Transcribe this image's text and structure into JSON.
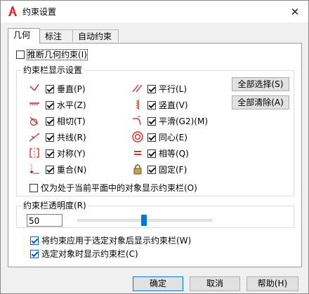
{
  "window": {
    "title": "约束设置",
    "close_glyph": "✕",
    "accent_color": "#0078d7"
  },
  "tabs": [
    {
      "label": "几何"
    },
    {
      "label": "标注"
    },
    {
      "label": "自动约束"
    }
  ],
  "infer": {
    "label": "推断几何约束(I)",
    "checked": false
  },
  "display_group": {
    "title": "约束栏显示设置",
    "left_items": [
      {
        "label": "垂直(P)",
        "icon": "perpendicular-icon",
        "checked": true
      },
      {
        "label": "水平(Z)",
        "icon": "horizontal-icon",
        "checked": true
      },
      {
        "label": "相切(T)",
        "icon": "tangent-icon",
        "checked": true
      },
      {
        "label": "共线(R)",
        "icon": "collinear-icon",
        "checked": true
      },
      {
        "label": "对称(Y)",
        "icon": "symmetric-icon",
        "checked": true
      },
      {
        "label": "重合(N)",
        "icon": "coincident-icon",
        "checked": true
      }
    ],
    "right_items": [
      {
        "label": "平行(L)",
        "icon": "parallel-icon",
        "checked": true
      },
      {
        "label": "竖直(V)",
        "icon": "vertical-icon",
        "checked": true
      },
      {
        "label": "平滑(G2)(M)",
        "icon": "smooth-icon",
        "checked": true
      },
      {
        "label": "同心(E)",
        "icon": "concentric-icon",
        "checked": true
      },
      {
        "label": "相等(Q)",
        "icon": "equal-icon",
        "checked": true
      },
      {
        "label": "固定(F)",
        "icon": "fix-lock-icon",
        "checked": true
      }
    ],
    "select_all": "全部选择(S)",
    "clear_all": "全部清除(A)",
    "current_plane_only": {
      "label": "仅为处于当前平面中的对象显示约束栏(O)",
      "checked": false
    }
  },
  "transparency_group": {
    "title": "约束栏透明度(R)",
    "value": "50",
    "slider_percent": 50
  },
  "show_after_apply": {
    "label": "将约束应用于选定对象后显示约束栏(W)",
    "checked": true
  },
  "show_on_select": {
    "label": "选定对象时显示约束栏(C)",
    "checked": true
  },
  "buttons": {
    "ok": "确定",
    "cancel": "取消",
    "help": "帮助(H)"
  }
}
